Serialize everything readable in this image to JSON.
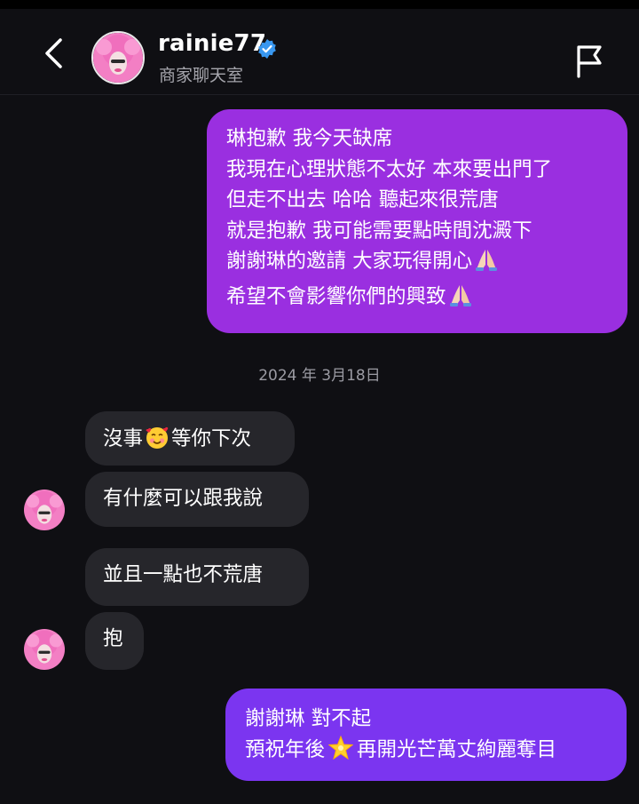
{
  "header": {
    "username": "rainie77",
    "subtitle": "商家聊天室",
    "verified_icon": "verified-badge-icon",
    "back_icon": "chevron-left-icon",
    "report_icon": "flag-icon"
  },
  "colors": {
    "background": "#0f0f13",
    "outgoing_bubble_1": "#9a2fe0",
    "outgoing_bubble_2": "#7b35f0",
    "incoming_bubble": "#26262b",
    "verified": "#3897f0"
  },
  "messages": {
    "outgoing_1": {
      "lines": [
        "琳抱歉 我今天缺席",
        "我現在心理狀態不太好 本來要出門了",
        "但走不出去 哈哈 聽起來很荒唐",
        "就是抱歉 我可能需要點時間沈澱下",
        "謝謝琳的邀請 大家玩得開心",
        "希望不會影響你們的興致"
      ],
      "emoji_line5": "🙏",
      "emoji_line6": "🙏"
    },
    "date": "2024 年 3月18日",
    "incoming": [
      {
        "text_before": "沒事",
        "emoji": "🥰",
        "text_after": "等你下次"
      },
      {
        "text": "有什麼可以跟我說"
      },
      {
        "text": "並且一點也不荒唐"
      },
      {
        "text": "抱"
      }
    ],
    "outgoing_2": {
      "line1": "謝謝琳 對不起",
      "line2_before": "預祝年後",
      "emoji": "🌟",
      "line2_after": "再開光芒萬丈絢麗奪目"
    }
  }
}
